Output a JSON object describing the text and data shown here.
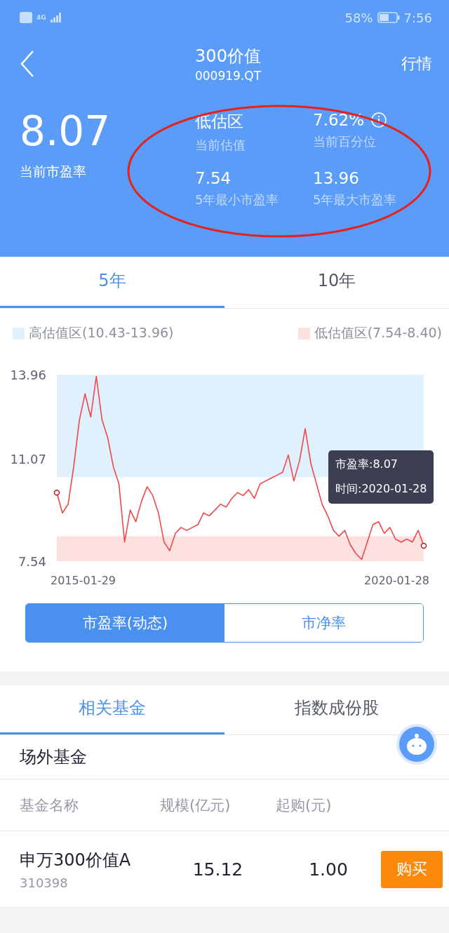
{
  "status_bar": {
    "network": "4G",
    "battery_percent": "58%",
    "time": "7:56"
  },
  "header": {
    "title": "300价值",
    "code": "000919.QT",
    "action": "行情"
  },
  "valuation": {
    "value": "8.07",
    "label": "当前市盈率",
    "stats": [
      {
        "value": "低估区",
        "label": "当前估值",
        "info": false
      },
      {
        "value": "7.62%",
        "label": "当前百分位",
        "info": true
      },
      {
        "value": "7.54",
        "label": "5年最小市盈率",
        "info": false
      },
      {
        "value": "13.96",
        "label": "5年最大市盈率",
        "info": false
      }
    ]
  },
  "period_tabs": [
    {
      "label": "5年",
      "selected": true
    },
    {
      "label": "10年",
      "selected": false
    }
  ],
  "legend": [
    {
      "label": "高估值区(10.43-13.96)",
      "color": "#e1f0fd"
    },
    {
      "label": "低估值区(7.54-8.40)",
      "color": "#fde1e1"
    }
  ],
  "chart": {
    "chart_data": {
      "type": "line",
      "ylim": [
        7.54,
        13.96
      ],
      "yticks": [
        13.96,
        11.07,
        7.54
      ],
      "series": [
        {
          "color": "#f04848",
          "values": [
            9.9,
            9.2,
            9.5,
            10.8,
            12.4,
            13.3,
            12.5,
            13.9,
            12.4,
            11.8,
            10.8,
            10.2,
            8.2,
            9.3,
            8.9,
            9.6,
            10.1,
            9.8,
            9.2,
            8.2,
            7.9,
            8.5,
            8.7,
            8.6,
            8.7,
            8.8,
            9.2,
            9.1,
            9.3,
            9.5,
            9.4,
            9.7,
            9.9,
            9.8,
            10.0,
            9.7,
            10.2,
            10.3,
            10.4,
            10.5,
            10.6,
            11.2,
            10.3,
            11.0,
            12.1,
            10.9,
            10.2,
            9.5,
            9.1,
            8.6,
            8.4,
            8.6,
            8.1,
            7.8,
            7.6,
            8.2,
            8.8,
            8.9,
            8.5,
            8.7,
            8.3,
            8.2,
            8.3,
            8.2,
            8.6,
            8.07
          ]
        }
      ],
      "bands": [
        {
          "axis": "y",
          "from": 10.43,
          "to": 13.96,
          "color": "#e1f0fd"
        },
        {
          "axis": "y",
          "from": 7.54,
          "to": 8.4,
          "color": "#fde1e1"
        }
      ]
    },
    "x_axis_labels": [
      "2015-01-29",
      "2020-01-28"
    ],
    "tooltip": [
      "市盈率:8.07",
      "时间:2020-01-28"
    ]
  },
  "metric_toggle": [
    {
      "label": "市盈率(动态)",
      "selected": true
    },
    {
      "label": "市净率",
      "selected": false
    }
  ],
  "section_tabs": [
    {
      "label": "相关基金",
      "selected": true
    },
    {
      "label": "指数成份股",
      "selected": false
    }
  ],
  "fund_section": {
    "title": "场外基金",
    "columns": [
      "基金名称",
      "规模(亿元)",
      "起购(元)"
    ],
    "rows": [
      {
        "name": "申万300价值A",
        "code": "310398",
        "size": "15.12",
        "min_purchase": "1.00",
        "action": "购买"
      }
    ]
  }
}
